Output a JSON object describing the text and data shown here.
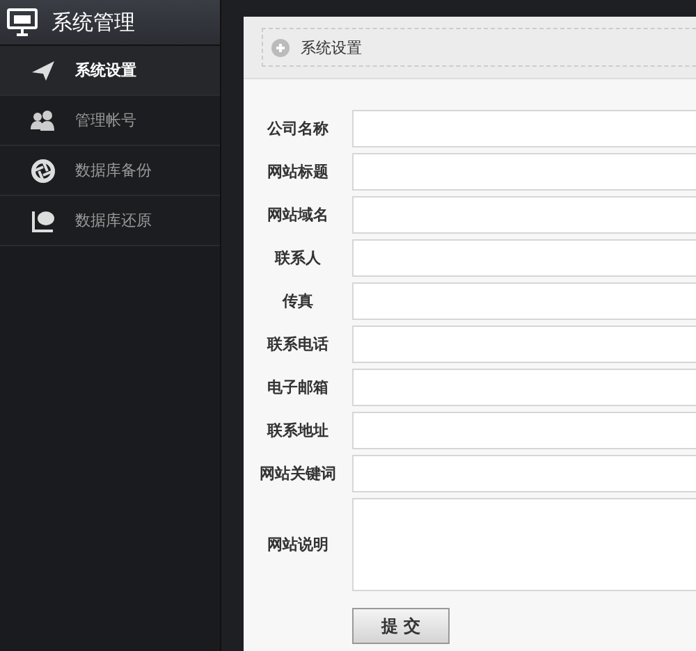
{
  "sidebar": {
    "title": "系统管理",
    "items": [
      {
        "label": "系统设置",
        "kind": "plane",
        "selected": true
      },
      {
        "label": "管理帐号",
        "kind": "users",
        "selected": false
      },
      {
        "label": "数据库备份",
        "kind": "aperture",
        "selected": false
      },
      {
        "label": "数据库还原",
        "kind": "chat",
        "selected": false
      }
    ]
  },
  "breadcrumb": "系统设置",
  "form": {
    "fields": [
      {
        "label": "公司名称",
        "kind": "input"
      },
      {
        "label": "网站标题",
        "kind": "input"
      },
      {
        "label": "网站域名",
        "kind": "input"
      },
      {
        "label": "联系人",
        "kind": "input"
      },
      {
        "label": "传真",
        "kind": "input"
      },
      {
        "label": "联系电话",
        "kind": "input"
      },
      {
        "label": "电子邮箱",
        "kind": "input"
      },
      {
        "label": "联系地址",
        "kind": "input"
      },
      {
        "label": "网站关键词",
        "kind": "input"
      },
      {
        "label": "网站说明",
        "kind": "textarea"
      }
    ],
    "submit": "提 交"
  }
}
